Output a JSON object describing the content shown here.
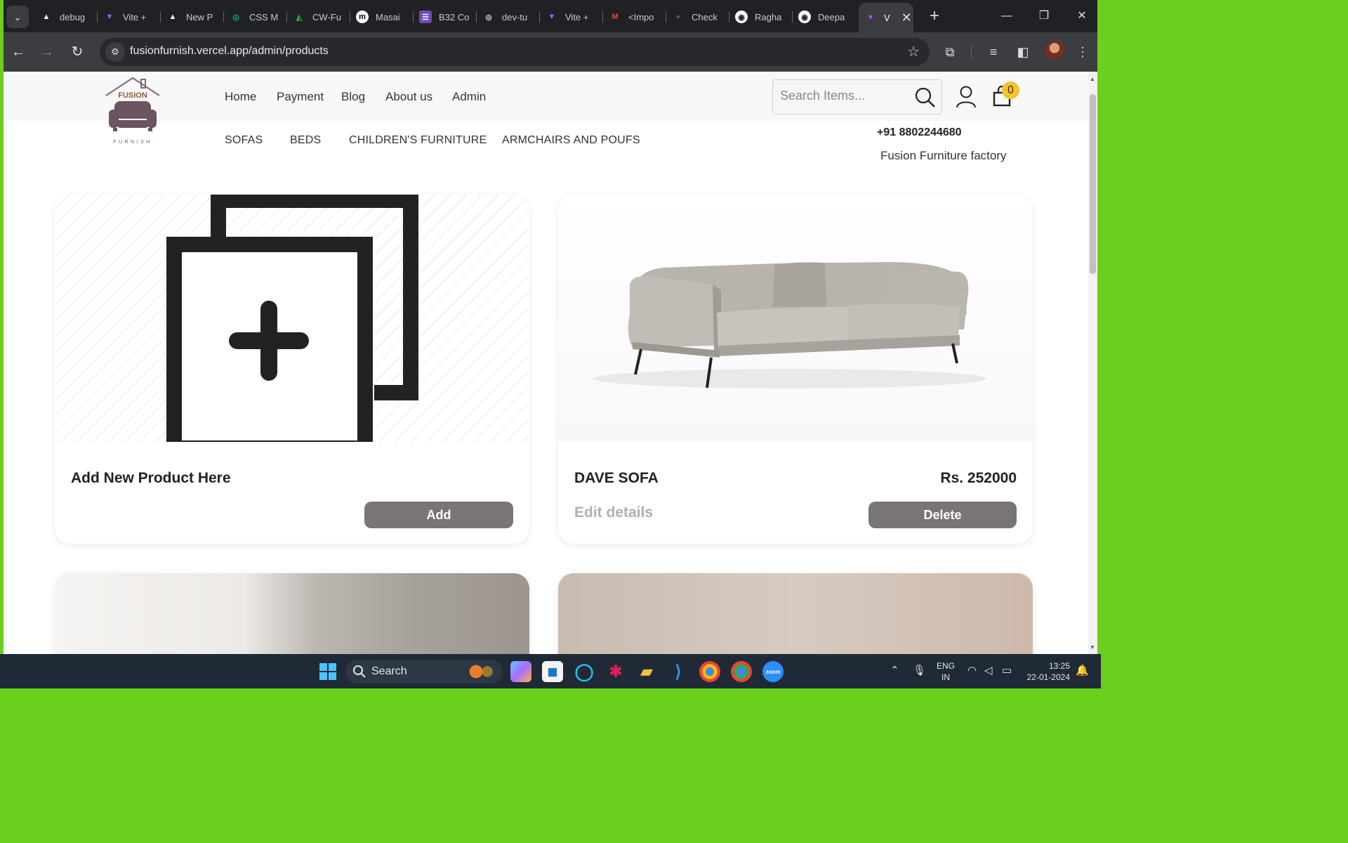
{
  "browser": {
    "tabs": [
      {
        "label": "debug",
        "fav_color": "#ffffff",
        "fav_glyph": "▲"
      },
      {
        "label": "Vite +",
        "fav_color": "#a855f7",
        "fav_glyph": "V"
      },
      {
        "label": "New P",
        "fav_color": "#ffffff",
        "fav_glyph": "▲"
      },
      {
        "label": "CSS M",
        "fav_color": "#10a37f",
        "fav_glyph": "◎"
      },
      {
        "label": "CW-Fu",
        "fav_color": "#34a853",
        "fav_glyph": "◭"
      },
      {
        "label": "Masai",
        "fav_color": "#ffffff",
        "fav_glyph": "m"
      },
      {
        "label": "B32 Co",
        "fav_color": "#7248b9",
        "fav_glyph": "☰"
      },
      {
        "label": "dev-tu",
        "fav_color": "#9aa0a6",
        "fav_glyph": "◍"
      },
      {
        "label": "Vite +",
        "fav_color": "#a855f7",
        "fav_glyph": "V"
      },
      {
        "label": "<Impo",
        "fav_color": "#ea4335",
        "fav_glyph": "M"
      },
      {
        "label": "Check",
        "fav_color": "#555555",
        "fav_glyph": "●"
      },
      {
        "label": "Ragha",
        "fav_color": "#ffffff",
        "fav_glyph": "◉"
      },
      {
        "label": "Deepa",
        "fav_color": "#ffffff",
        "fav_glyph": "◉"
      }
    ],
    "active_tab": {
      "label": "V",
      "fav_color": "#a855f7",
      "fav_glyph": "V"
    },
    "url": "fusionfurnish.vercel.app/admin/products"
  },
  "site": {
    "logo_text_top": "FUSION",
    "logo_text_bottom": "FURNISH",
    "nav": [
      "Home",
      "Payment",
      "Blog",
      "About us",
      "Admin"
    ],
    "search_placeholder": "Search Items...",
    "cart_count": "0",
    "categories": [
      "SOFAS",
      "BEDS",
      "CHILDREN'S FURNITURE",
      "ARMCHAIRS AND POUFS"
    ],
    "phone": "+91 8802244680",
    "factory": "Fusion Furniture factory"
  },
  "cards": {
    "add_card": {
      "title": "Add New Product Here",
      "button": "Add"
    },
    "product_card": {
      "title": "DAVE SOFA",
      "price": "Rs. 252000",
      "edit_link": "Edit details",
      "button": "Delete"
    }
  },
  "taskbar": {
    "search_label": "Search",
    "lang_line1": "ENG",
    "lang_line2": "IN",
    "time": "13:25",
    "date": "22-01-2024"
  },
  "colors": {
    "accent_button": "#797576",
    "cart_badge": "#f4c430",
    "logo_brown": "#6b5560"
  }
}
